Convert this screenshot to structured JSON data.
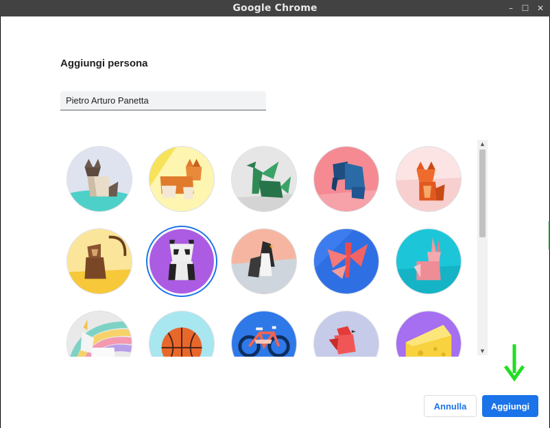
{
  "window": {
    "title": "Google Chrome",
    "minimize_glyph": "–",
    "maximize_glyph": "☐",
    "close_glyph": "✕"
  },
  "dialog": {
    "heading": "Aggiungi persona",
    "name_input_value": "Pietro Arturo Panetta"
  },
  "avatars": [
    {
      "name": "cat",
      "selected": false
    },
    {
      "name": "corgi",
      "selected": false
    },
    {
      "name": "dragon",
      "selected": false
    },
    {
      "name": "elephant",
      "selected": false
    },
    {
      "name": "fox",
      "selected": false
    },
    {
      "name": "monkey",
      "selected": false
    },
    {
      "name": "panda",
      "selected": true
    },
    {
      "name": "penguin",
      "selected": false
    },
    {
      "name": "butterfly",
      "selected": false
    },
    {
      "name": "rabbit",
      "selected": false
    },
    {
      "name": "unicorn",
      "selected": false
    },
    {
      "name": "basketball",
      "selected": false
    },
    {
      "name": "bicycle",
      "selected": false
    },
    {
      "name": "bird",
      "selected": false
    },
    {
      "name": "cheese",
      "selected": false
    }
  ],
  "scrollbar": {
    "up_glyph": "▲",
    "down_glyph": "▼"
  },
  "buttons": {
    "cancel_label": "Annulla",
    "add_label": "Aggiungi"
  },
  "colors": {
    "accent": "#1a73e8",
    "annotation_arrow": "#22dd22",
    "titlebar": "#424242"
  }
}
